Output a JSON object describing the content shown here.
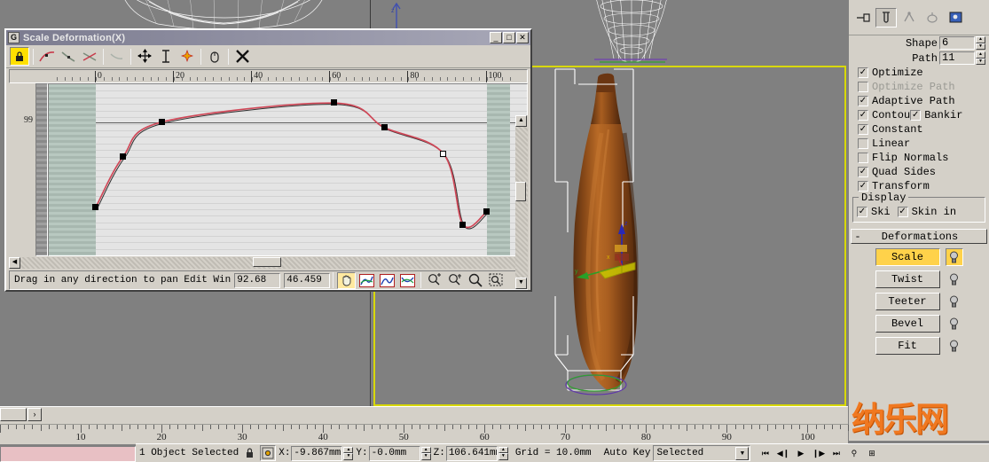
{
  "dialog": {
    "title": "Scale Deformation(X)",
    "app_icon": "loft-icon",
    "minimize_label": "_",
    "maximize_label": "□",
    "close_label": "✕",
    "toolbar": [
      {
        "name": "make-symmetrical-button",
        "icon": "lock-symmetry-icon",
        "active": true
      },
      {
        "name": "move-control-point-button",
        "icon": "red-curve-icon",
        "active": false
      },
      {
        "name": "scale-control-point-button",
        "icon": "gray-curve-icon",
        "active": false
      },
      {
        "name": "insert-corner-point-button",
        "icon": "cross-curve-icon",
        "active": false
      },
      {
        "name": "delete-control-point-button",
        "icon": "faint-curve-icon",
        "active": false
      },
      {
        "name": "move-button",
        "icon": "move-arrows-icon",
        "active": false
      },
      {
        "name": "scale-button",
        "icon": "scale-vertical-icon",
        "active": false
      },
      {
        "name": "insert-bezier-point-button",
        "icon": "insert-star-icon",
        "active": false
      },
      {
        "name": "reset-curve-button",
        "icon": "mouse-icon",
        "active": false
      },
      {
        "name": "delete-button",
        "icon": "x-delete-icon",
        "active": false
      }
    ],
    "ruler_labels": [
      "0",
      "20",
      "40",
      "60",
      "80",
      "100"
    ],
    "y_axis_label": "99",
    "status_text": "Drag in any direction to pan Edit Win",
    "field_x": "92.68",
    "field_y": "46.459",
    "nav_buttons": [
      {
        "name": "pan-button",
        "icon": "hand-icon",
        "active": true
      },
      {
        "name": "zoom-extents-button",
        "icon": "zoom-extents-icon",
        "active": false
      },
      {
        "name": "zoom-horizontal-extents-button",
        "icon": "zoom-h-extents-icon",
        "active": false
      },
      {
        "name": "zoom-vertical-extents-button",
        "icon": "zoom-v-extents-icon",
        "active": false
      },
      {
        "name": "zoom-horizontal-button",
        "icon": "zoom-horiz-icon",
        "active": false
      },
      {
        "name": "zoom-vertical-button",
        "icon": "zoom-vert-icon",
        "active": false
      },
      {
        "name": "zoom-button",
        "icon": "magnifier-icon",
        "active": false
      },
      {
        "name": "zoom-region-button",
        "icon": "zoom-region-icon",
        "active": false
      }
    ]
  },
  "chart_data": {
    "type": "line",
    "title": "Scale Deformation(X)",
    "xlabel": "",
    "ylabel": "99",
    "xlim": [
      -12,
      106
    ],
    "ylim": [
      0,
      118
    ],
    "grid": true,
    "legend": null,
    "series": [
      {
        "name": "scale-x-curve",
        "color": "#d04858",
        "points": [
          {
            "x": 0,
            "y": 33
          },
          {
            "x": 7,
            "y": 68
          },
          {
            "x": 17,
            "y": 92
          },
          {
            "x": 61,
            "y": 105
          },
          {
            "x": 74,
            "y": 88
          },
          {
            "x": 89,
            "y": 70
          },
          {
            "x": 94,
            "y": 21
          },
          {
            "x": 100,
            "y": 30
          }
        ]
      }
    ],
    "control_points": [
      {
        "x": 0,
        "y": 33,
        "type": "corner"
      },
      {
        "x": 7,
        "y": 68,
        "type": "corner"
      },
      {
        "x": 17,
        "y": 92,
        "type": "corner"
      },
      {
        "x": 61,
        "y": 105,
        "type": "corner"
      },
      {
        "x": 74,
        "y": 88,
        "type": "corner"
      },
      {
        "x": 89,
        "y": 70,
        "type": "hollow"
      },
      {
        "x": 94,
        "y": 21,
        "type": "corner"
      },
      {
        "x": 100,
        "y": 30,
        "type": "corner"
      }
    ]
  },
  "command_panel": {
    "tabs": [
      {
        "name": "create-tab",
        "icon": "pin-icon",
        "selected": false
      },
      {
        "name": "modify-tab",
        "icon": "bent-tube-icon",
        "selected": true
      },
      {
        "name": "hierarchy-tab",
        "icon": "hierarchy-icon",
        "selected": false
      },
      {
        "name": "motion-tab",
        "icon": "wheel-icon",
        "selected": false
      },
      {
        "name": "display-tab",
        "icon": "display-monitor-icon",
        "selected": false
      }
    ],
    "spinners": [
      {
        "label": "Shape",
        "value": "6"
      },
      {
        "label": "Path",
        "value": "11"
      }
    ],
    "checkboxes": [
      {
        "label": "Optimize",
        "checked": true,
        "disabled": false
      },
      {
        "label": "Optimize Path",
        "checked": false,
        "disabled": true
      },
      {
        "label": "Adaptive Path",
        "checked": true,
        "disabled": false
      },
      {
        "label": "Contou",
        "checked": true,
        "disabled": false
      },
      {
        "label": "Bankir",
        "checked": true,
        "disabled": false
      },
      {
        "label": "Constant",
        "checked": true,
        "disabled": false
      },
      {
        "label": "Linear",
        "checked": false,
        "disabled": false
      },
      {
        "label": "Flip Normals",
        "checked": false,
        "disabled": false
      },
      {
        "label": "Quad Sides",
        "checked": true,
        "disabled": false
      },
      {
        "label": "Transform",
        "checked": true,
        "disabled": false
      }
    ],
    "display_group": {
      "title": "Display",
      "items": [
        {
          "label": "Ski",
          "checked": true
        },
        {
          "label": "Skin in",
          "checked": true
        }
      ]
    },
    "deformations": {
      "rollout_title": "Deformations",
      "collapse_glyph": "-",
      "buttons": [
        {
          "label": "Scale",
          "active": true,
          "bulb": "lightbulb-icon"
        },
        {
          "label": "Twist",
          "active": false,
          "bulb": "lightbulb-icon"
        },
        {
          "label": "Teeter",
          "active": false,
          "bulb": "lightbulb-icon"
        },
        {
          "label": "Bevel",
          "active": false,
          "bulb": "lightbulb-icon"
        },
        {
          "label": "Fit",
          "active": false,
          "bulb": "lightbulb-icon"
        }
      ]
    }
  },
  "timeline": {
    "labels": [
      "10",
      "20",
      "30",
      "40",
      "50",
      "60",
      "70",
      "80",
      "90",
      "100"
    ],
    "next_frame_glyph": "›"
  },
  "status_bar": {
    "selection_text": "1 Object Selected",
    "lock_icon": "lock-selection-icon",
    "coord_mode_icon": "absolute-mode-icon",
    "coords": [
      {
        "label": "X:",
        "value": "-9.867mm"
      },
      {
        "label": "Y:",
        "value": "-0.0mm"
      },
      {
        "label": "Z:",
        "value": "106.641mm"
      }
    ],
    "grid_text": "Grid = 10.0mm",
    "auto_key_label": "Auto Key",
    "selection_level": "Selected",
    "dropdown_arrow": "▼",
    "playback": [
      {
        "name": "go-to-start-button",
        "icon": "skip-start-icon"
      },
      {
        "name": "previous-frame-button",
        "icon": "step-back-icon"
      },
      {
        "name": "play-button",
        "icon": "play-icon"
      },
      {
        "name": "next-frame-button",
        "icon": "step-forward-icon"
      },
      {
        "name": "go-to-end-button",
        "icon": "skip-end-icon"
      },
      {
        "name": "zoom-tool-button",
        "icon": "magnifier-icon"
      },
      {
        "name": "zoom-all-button",
        "icon": "zoom-all-icon"
      }
    ]
  },
  "viewport": {
    "active_border_color": "#d8d800",
    "object_color": "#9c5520",
    "background_color": "#808080",
    "gizmo": {
      "x_axis_color": "#c02020",
      "y_axis_color": "#20a020",
      "z_axis_color": "#2020c0",
      "highlight_color": "#d8d800"
    }
  },
  "watermark": {
    "text": "纳乐网"
  }
}
